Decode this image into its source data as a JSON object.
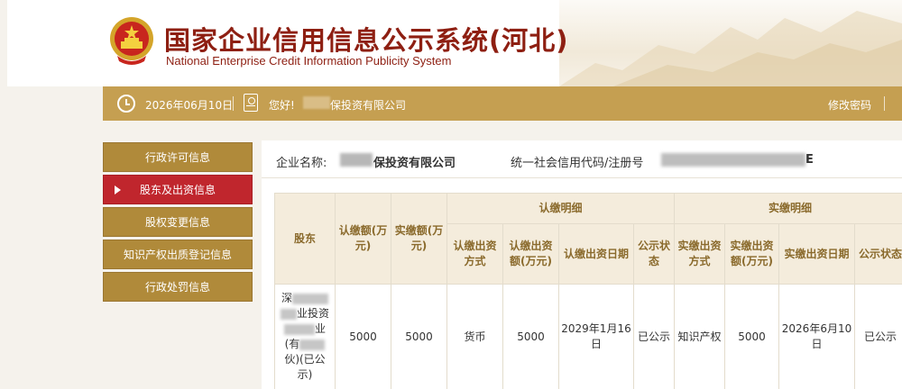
{
  "header": {
    "title_cn": "国家企业信用信息公示系统(河北)",
    "title_en": "National Enterprise Credit Information Publicity System"
  },
  "infobar": {
    "date": "2026年06月10日",
    "greeting": "您好!",
    "company": "保投资有限公司",
    "change_password": "修改密码"
  },
  "sidebar": {
    "items": [
      {
        "label": "行政许可信息",
        "active": false
      },
      {
        "label": "股东及出资信息",
        "active": true
      },
      {
        "label": "股权变更信息",
        "active": false
      },
      {
        "label": "知识产权出质登记信息",
        "active": false
      },
      {
        "label": "行政处罚信息",
        "active": false
      }
    ]
  },
  "main": {
    "company_label": "企业名称:",
    "company_value": "保投资有限公司",
    "credit_code_label": "统一社会信用代码/注册号",
    "credit_code_suffix": "E"
  },
  "table": {
    "headers": {
      "shareholder": "股东",
      "subscribed_amount": "认缴额(万元)",
      "paid_amount": "实缴额(万元)",
      "subscribed_detail": "认缴明细",
      "paid_detail": "实缴明细",
      "sub_method": "认缴出资方式",
      "sub_amount": "认缴出资额(万元)",
      "sub_date": "认缴出资日期",
      "sub_status": "公示状态",
      "paid_method": "实缴出资方式",
      "paid_amount_detail": "实缴出资额(万元)",
      "paid_date": "实缴出资日期",
      "paid_status": "公示状态"
    },
    "rows": [
      {
        "shareholder_line1": "深",
        "shareholder_line2": "业投资",
        "shareholder_line3": "业",
        "shareholder_line4": "(有",
        "shareholder_line5": "伙)(已公示)",
        "subscribed": "5000",
        "paid": "5000",
        "sub_method": "货币",
        "sub_amount": "5000",
        "sub_date": "2029年1月16日",
        "sub_status": "已公示",
        "paid_method": "知识产权",
        "paid_amount": "5000",
        "paid_date": "2026年6月10日",
        "paid_status": "已公示"
      }
    ]
  }
}
